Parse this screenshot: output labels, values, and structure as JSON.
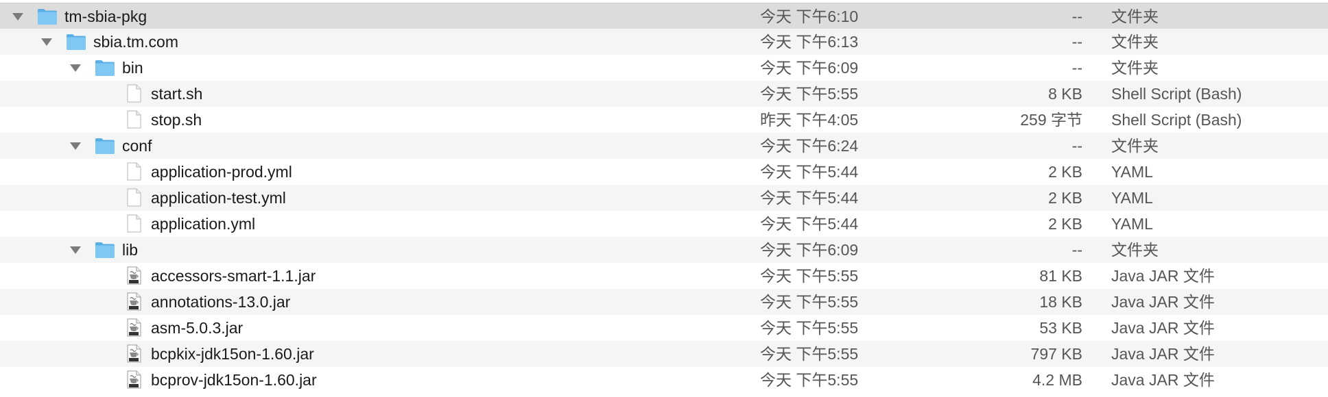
{
  "colors": {
    "folder_blue": "#7ec8f3",
    "folder_blue_dark": "#5aaee6",
    "selected_row": "#dcdcdc",
    "stripe_row": "#f4f5f5"
  },
  "rows": [
    {
      "name": "tm-sbia-pkg",
      "date": "今天 下午6:10",
      "size": "--",
      "kind": "文件夹",
      "type": "folder",
      "depth": 0,
      "expanded": true,
      "selected": true,
      "icon": "folder-icon"
    },
    {
      "name": "sbia.tm.com",
      "date": "今天 下午6:13",
      "size": "--",
      "kind": "文件夹",
      "type": "folder",
      "depth": 1,
      "expanded": true,
      "icon": "folder-icon"
    },
    {
      "name": "bin",
      "date": "今天 下午6:09",
      "size": "--",
      "kind": "文件夹",
      "type": "folder",
      "depth": 2,
      "expanded": true,
      "icon": "folder-icon"
    },
    {
      "name": "start.sh",
      "date": "今天 下午5:55",
      "size": "8 KB",
      "kind": "Shell Script (Bash)",
      "type": "file",
      "depth": 3,
      "icon": "document-icon"
    },
    {
      "name": "stop.sh",
      "date": "昨天 下午4:05",
      "size": "259 字节",
      "kind": "Shell Script (Bash)",
      "type": "file",
      "depth": 3,
      "icon": "document-icon"
    },
    {
      "name": "conf",
      "date": "今天 下午6:24",
      "size": "--",
      "kind": "文件夹",
      "type": "folder",
      "depth": 2,
      "expanded": true,
      "icon": "folder-icon"
    },
    {
      "name": "application-prod.yml",
      "date": "今天 下午5:44",
      "size": "2 KB",
      "kind": "YAML",
      "type": "file",
      "depth": 3,
      "icon": "document-icon"
    },
    {
      "name": "application-test.yml",
      "date": "今天 下午5:44",
      "size": "2 KB",
      "kind": "YAML",
      "type": "file",
      "depth": 3,
      "icon": "document-icon"
    },
    {
      "name": "application.yml",
      "date": "今天 下午5:44",
      "size": "2 KB",
      "kind": "YAML",
      "type": "file",
      "depth": 3,
      "icon": "document-icon"
    },
    {
      "name": "lib",
      "date": "今天 下午6:09",
      "size": "--",
      "kind": "文件夹",
      "type": "folder",
      "depth": 2,
      "expanded": true,
      "icon": "folder-icon"
    },
    {
      "name": "accessors-smart-1.1.jar",
      "date": "今天 下午5:55",
      "size": "81 KB",
      "kind": "Java JAR 文件",
      "type": "jar",
      "depth": 3,
      "icon": "jar-file-icon"
    },
    {
      "name": "annotations-13.0.jar",
      "date": "今天 下午5:55",
      "size": "18 KB",
      "kind": "Java JAR 文件",
      "type": "jar",
      "depth": 3,
      "icon": "jar-file-icon"
    },
    {
      "name": "asm-5.0.3.jar",
      "date": "今天 下午5:55",
      "size": "53 KB",
      "kind": "Java JAR 文件",
      "type": "jar",
      "depth": 3,
      "icon": "jar-file-icon"
    },
    {
      "name": "bcpkix-jdk15on-1.60.jar",
      "date": "今天 下午5:55",
      "size": "797 KB",
      "kind": "Java JAR 文件",
      "type": "jar",
      "depth": 3,
      "icon": "jar-file-icon"
    },
    {
      "name": "bcprov-jdk15on-1.60.jar",
      "date": "今天 下午5:55",
      "size": "4.2 MB",
      "kind": "Java JAR 文件",
      "type": "jar",
      "depth": 3,
      "icon": "jar-file-icon"
    }
  ]
}
